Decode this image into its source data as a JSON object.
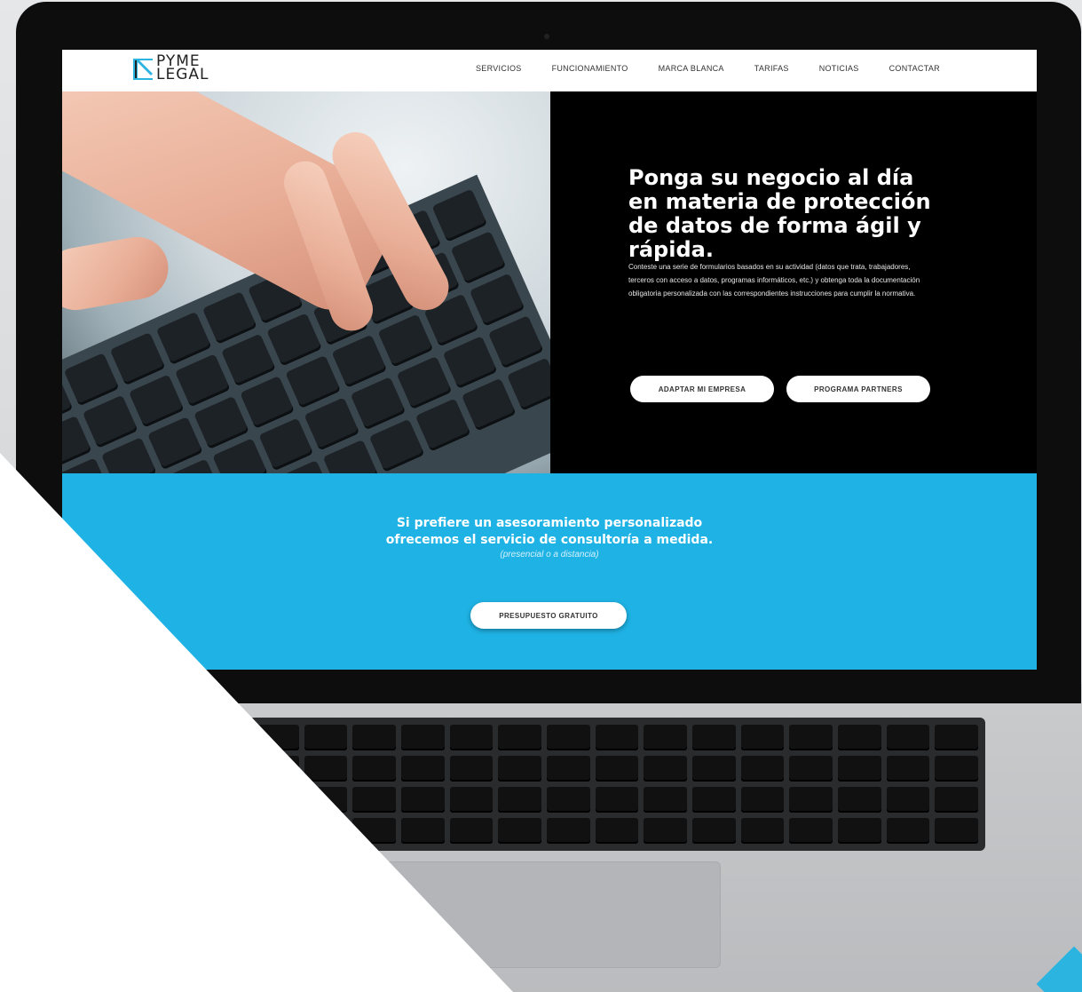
{
  "nav": {
    "logo_line1": "PYME",
    "logo_line2": "LEGAL",
    "links": [
      "SERVICIOS",
      "FUNCIONAMIENTO",
      "MARCA BLANCA",
      "TARIFAS",
      "NOTICIAS",
      "CONTACTAR"
    ]
  },
  "hero": {
    "title": "Ponga su negocio al día en materia de protección de datos de forma ágil y rápida.",
    "text": "Conteste una serie de formularios basados en su actividad (datos que trata, trabajadores, terceros con acceso a datos, programas informáticos, etc.) y obtenga toda la documentación obligatoria personalizada con las correspondientes instrucciones para cumplir la normativa.",
    "button_adapt": "ADAPTAR MI EMPRESA",
    "button_partner": "PROGRAMA PARTNERS"
  },
  "consult": {
    "title_line1": "Si prefiere un asesoramiento personalizado",
    "title_line2": "ofrecemos el servicio de consultoría a medida.",
    "note": "(presencial o a distancia)",
    "button": "PRESUPUESTO GRATUITO"
  },
  "colors": {
    "accent_blue": "#1fb3e5",
    "hero_dark": "#000000",
    "nav_bg": "#ffffff"
  },
  "icons": {
    "logo": "pyme-legal-logo-mark"
  }
}
